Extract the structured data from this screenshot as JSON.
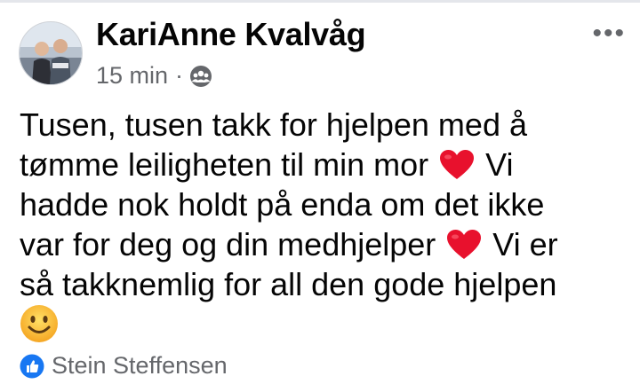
{
  "post": {
    "author": "KariAnne Kvalvåg",
    "time": "15 min",
    "separator": "·",
    "audience_icon": "friends-globe-icon",
    "more_label": "•••",
    "text": {
      "line1": "Tusen, tusen takk for hjelpen med å",
      "line2a": "tømme leiligheten til min mor ",
      "line2b": " Vi",
      "line3": "hadde nok holdt på enda om det ikke",
      "line4a": "var for deg og din medhjelper ",
      "line4b": " Vi er",
      "line5": "så takknemlig for all den gode hjelpen"
    },
    "emojis": [
      "red-heart-icon",
      "red-heart-icon",
      "smiling-face-icon"
    ],
    "reactions": {
      "icon": "like-icon",
      "color": "#1877f2",
      "names": "Stein Steffensen"
    }
  }
}
